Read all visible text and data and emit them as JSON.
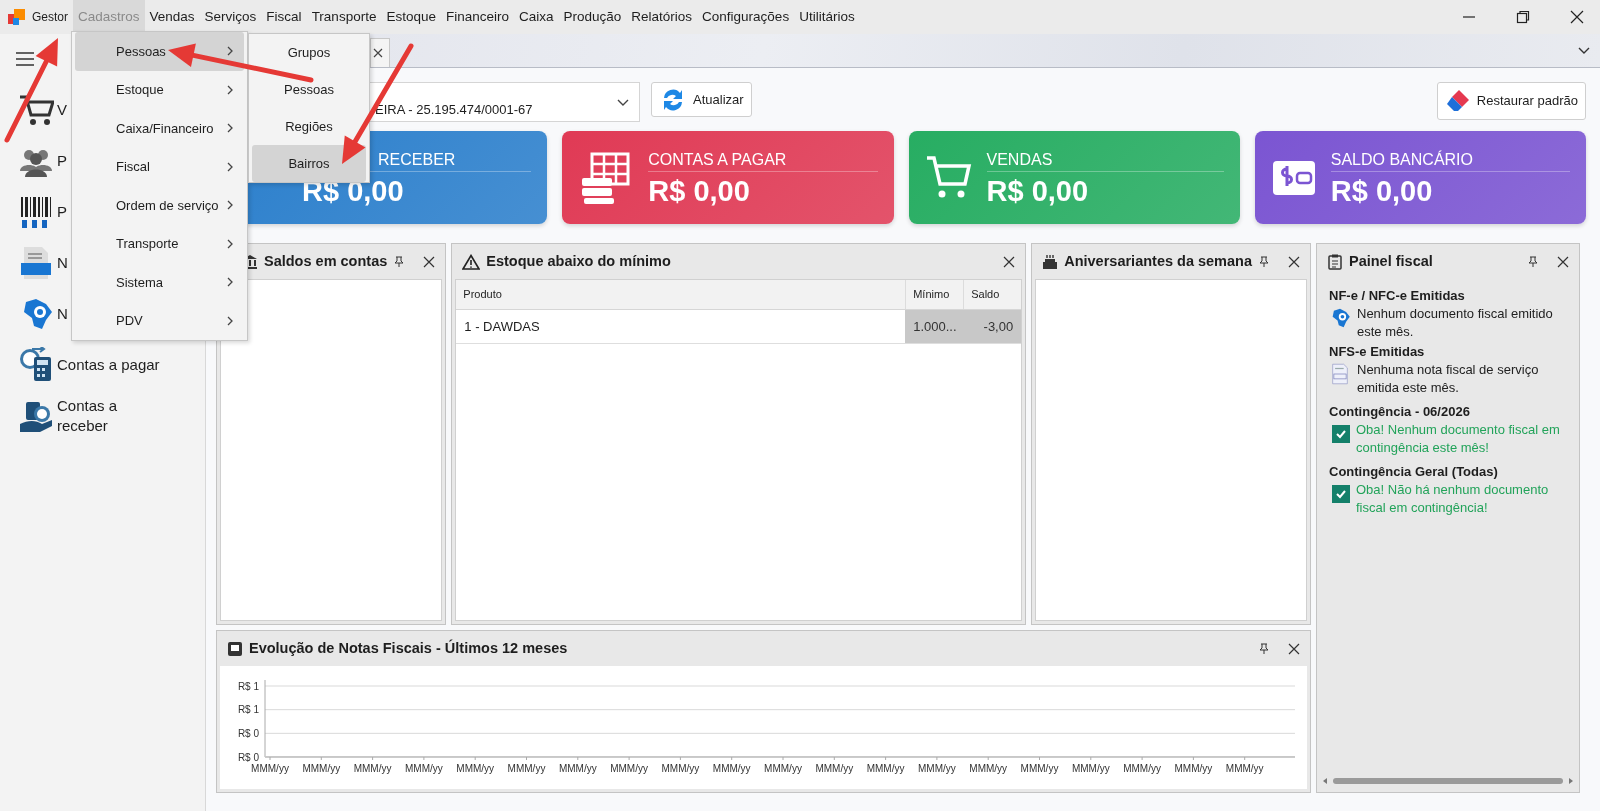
{
  "app": {
    "name": "Gestor"
  },
  "menu_bar": [
    {
      "label": "Cadastros",
      "selected": true
    },
    {
      "label": "Vendas",
      "selected": false
    },
    {
      "label": "Serviços",
      "selected": false
    },
    {
      "label": "Fiscal",
      "selected": false
    },
    {
      "label": "Transporte",
      "selected": false
    },
    {
      "label": "Estoque",
      "selected": false
    },
    {
      "label": "Financeiro",
      "selected": false
    },
    {
      "label": "Caixa",
      "selected": false
    },
    {
      "label": "Produção",
      "selected": false
    },
    {
      "label": "Relatórios",
      "selected": false
    },
    {
      "label": "Configurações",
      "selected": false
    },
    {
      "label": "Utilitários",
      "selected": false
    }
  ],
  "dropdown_menu": [
    {
      "label": "Pessoas",
      "selected": true
    },
    {
      "label": "Estoque",
      "selected": false
    },
    {
      "label": "Caixa/Financeiro",
      "selected": false
    },
    {
      "label": "Fiscal",
      "selected": false
    },
    {
      "label": "Ordem de serviço",
      "selected": false
    },
    {
      "label": "Transporte",
      "selected": false
    },
    {
      "label": "Sistema",
      "selected": false
    },
    {
      "label": "PDV",
      "selected": false
    }
  ],
  "submenu": [
    {
      "label": "Grupos",
      "selected": false
    },
    {
      "label": "Pessoas",
      "selected": false
    },
    {
      "label": "Regiões",
      "selected": false
    },
    {
      "label": "Bairros",
      "selected": true
    }
  ],
  "sidebar": {
    "items": [
      {
        "label": "V",
        "kind": "cart"
      },
      {
        "label": "P",
        "kind": "people"
      },
      {
        "label": "P",
        "kind": "barcode"
      },
      {
        "label": "N",
        "kind": "nfse"
      },
      {
        "label": "N",
        "kind": "nfe"
      },
      {
        "label": "Contas a pagar",
        "kind": "payable"
      },
      {
        "label": "Contas a receber",
        "kind": "receivable"
      }
    ]
  },
  "company_select": {
    "value": "EIRA - 25.195.474/0001-67"
  },
  "buttons": [
    {
      "label": "Atualizar",
      "kind": "refresh"
    },
    {
      "label": "Restaurar padrão",
      "kind": "eraser"
    }
  ],
  "cards": [
    {
      "title": "RECEBER",
      "value": "R$ 0,00",
      "color": "#2b7fcc"
    },
    {
      "title": "CONTAS A PAGAR",
      "value": "R$ 0,00",
      "color": "#e03a55",
      "kind": "table"
    },
    {
      "title": "VENDAS",
      "value": "R$ 0,00",
      "color": "#27ad62",
      "kind": "cart"
    },
    {
      "title": "SALDO BANCÁRIO",
      "value": "R$ 0,00",
      "color": "#7b55d2",
      "kind": "wallet"
    }
  ],
  "panels": {
    "saldos": {
      "title": "Saldos em contas",
      "pin": true
    },
    "estoque": {
      "title": "Estoque abaixo do mínimo",
      "pin": false,
      "columns": [
        "Produto",
        "Mínimo",
        "Saldo"
      ],
      "rows": [
        [
          "1 - DAWDAS",
          "1.000...",
          "-3,00"
        ]
      ]
    },
    "aniversariantes": {
      "title": "Aniversariantes da semana",
      "pin": true
    },
    "fiscal": {
      "title": "Painel fiscal",
      "pin": true,
      "sections": [
        {
          "heading": "NF-e / NFC-e Emitidas",
          "kind": "nfe",
          "text": "Nenhum documento fiscal emitido este mês."
        },
        {
          "heading": "NFS-e Emitidas",
          "kind": "nfse",
          "text": "Nenhuma nota fiscal de serviço emitida este mês."
        },
        {
          "heading": "Contingência - 06/2026",
          "kind": "check",
          "checked": true,
          "text": "Oba! Nenhum documento fiscal em contingência este mês!"
        },
        {
          "heading": "Contingência Geral (Todas)",
          "kind": "check",
          "checked": true,
          "text": "Oba! Não há nenhum documento fiscal em contingência!"
        }
      ]
    },
    "chart": {
      "title": "Evolução de Notas Fiscais - Últimos 12 meses",
      "pin": true,
      "y_axis_labels": [
        "R$ 1",
        "R$ 1",
        "R$ 0",
        "R$ 0"
      ],
      "chart_data": {
        "type": "other",
        "categories": [
          "MMM/yy",
          "MMM/yy",
          "MMM/yy",
          "MMM/yy",
          "MMM/yy",
          "MMM/yy",
          "MMM/yy",
          "MMM/yy",
          "MMM/yy",
          "MMM/yy",
          "MMM/yy",
          "MMM/yy",
          "MMM/yy",
          "MMM/yy",
          "MMM/yy",
          "MMM/yy",
          "MMM/yy",
          "MMM/yy",
          "MMM/yy",
          "MMM/yy"
        ]
      }
    }
  }
}
